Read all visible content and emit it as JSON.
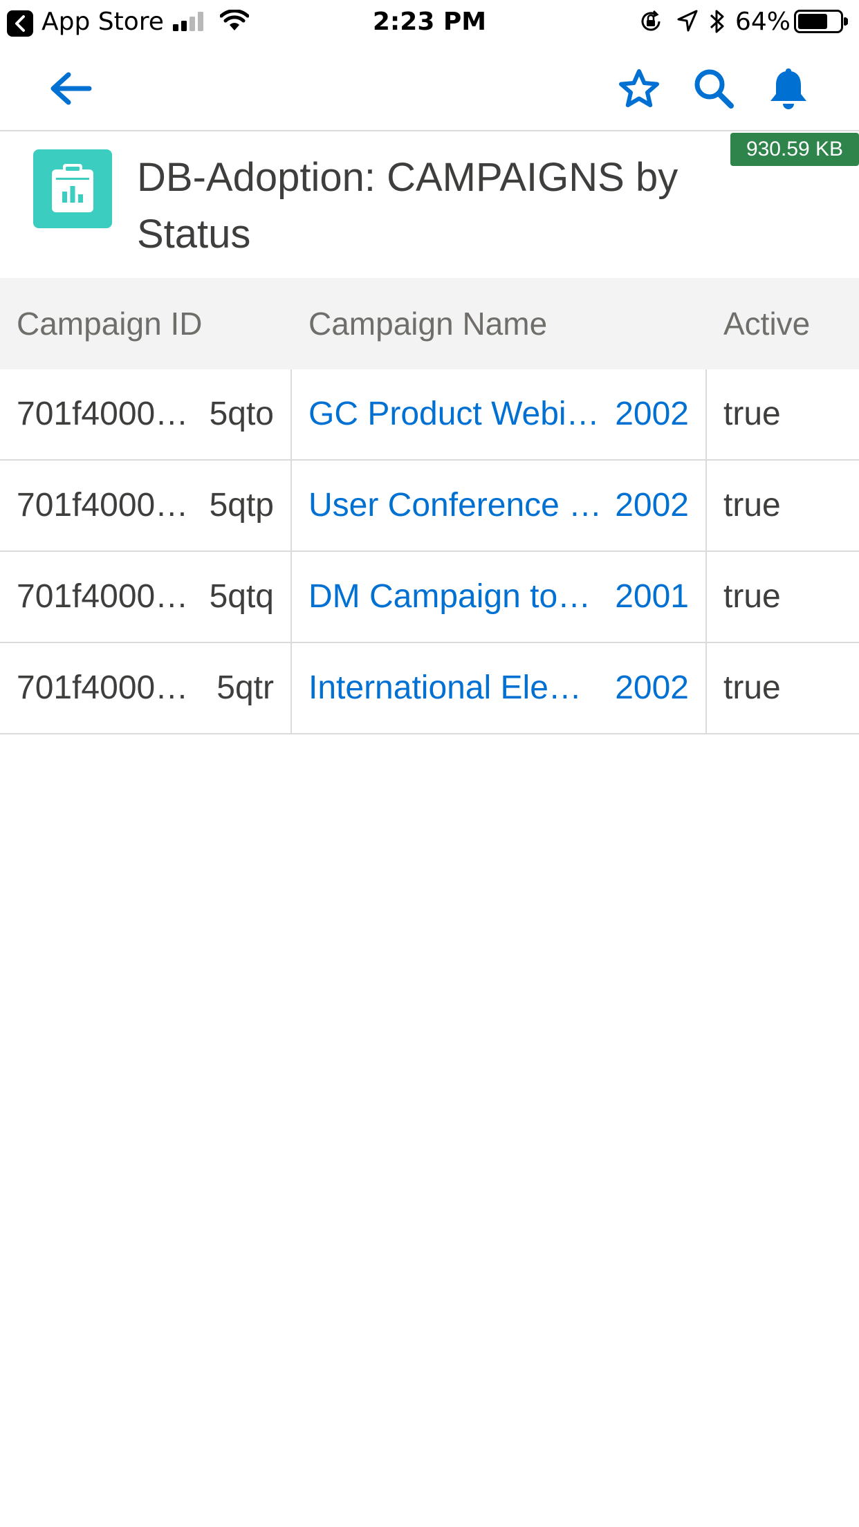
{
  "status_bar": {
    "carrier": "App Store",
    "time": "2:23 PM",
    "battery": "64%"
  },
  "nav": {
    "icons": [
      "back-arrow-icon",
      "star-icon",
      "search-icon",
      "bell-icon"
    ],
    "accent_color": "#0070d2"
  },
  "header": {
    "size_badge": "930.59 KB",
    "title": "DB-Adoption: CAMPAIGNS by Status",
    "icon": "report-icon",
    "icon_color": "#3bcdbf"
  },
  "table": {
    "columns": [
      "Campaign ID",
      "Campaign Name",
      "Active"
    ],
    "rows": [
      {
        "id_start": "701f4000…",
        "id_end": "5qto",
        "name": "GC Product Webi…",
        "year": "2002",
        "active": "true"
      },
      {
        "id_start": "701f4000…",
        "id_end": "5qtp",
        "name": "User Conference …",
        "year": "2002",
        "active": "true"
      },
      {
        "id_start": "701f4000…",
        "id_end": "5qtq",
        "name": "DM Campaign to…",
        "year": "2001",
        "active": "true"
      },
      {
        "id_start": "701f4000…",
        "id_end": "5qtr",
        "name": "International Ele…",
        "year": "2002",
        "active": "true"
      }
    ]
  }
}
